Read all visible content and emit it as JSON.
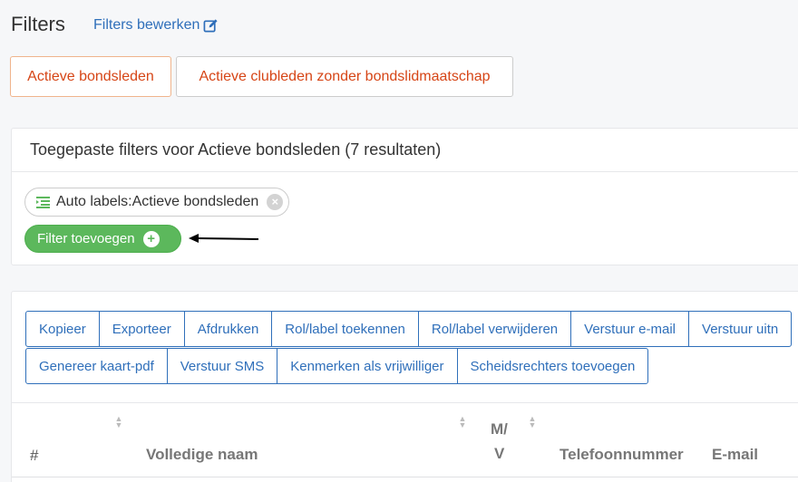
{
  "header": {
    "title": "Filters",
    "edit_link": "Filters bewerken"
  },
  "filter_tabs": [
    {
      "label": "Actieve bondsleden",
      "active": true
    },
    {
      "label": "Actieve clubleden zonder bondslidmaatschap",
      "active": false
    }
  ],
  "applied": {
    "title": "Toegepaste filters voor Actieve bondsleden (7 resultaten)",
    "chip_label": "Auto labels:Actieve bondsleden",
    "chip_icon": "list-icon",
    "add_filter_label": "Filter toevoegen"
  },
  "toolbar": {
    "row1": [
      "Kopieer",
      "Exporteer",
      "Afdrukken",
      "Rol/label toekennen",
      "Rol/label verwijderen",
      "Verstuur e-mail",
      "Verstuur uitn"
    ],
    "row2": [
      "Genereer kaart-pdf",
      "Verstuur SMS",
      "Kenmerken als vrijwilliger",
      "Scheidsrechters toevoegen"
    ]
  },
  "table": {
    "columns": {
      "number": "#",
      "name": "Volledige naam",
      "gender_top": "M/",
      "gender_bottom": "V",
      "phone": "Telefoonnummer",
      "email": "E-mail"
    }
  },
  "colors": {
    "link": "#2f6fba",
    "tab_text": "#d64516",
    "green": "#5cb85c",
    "background": "#f6f7f9"
  }
}
